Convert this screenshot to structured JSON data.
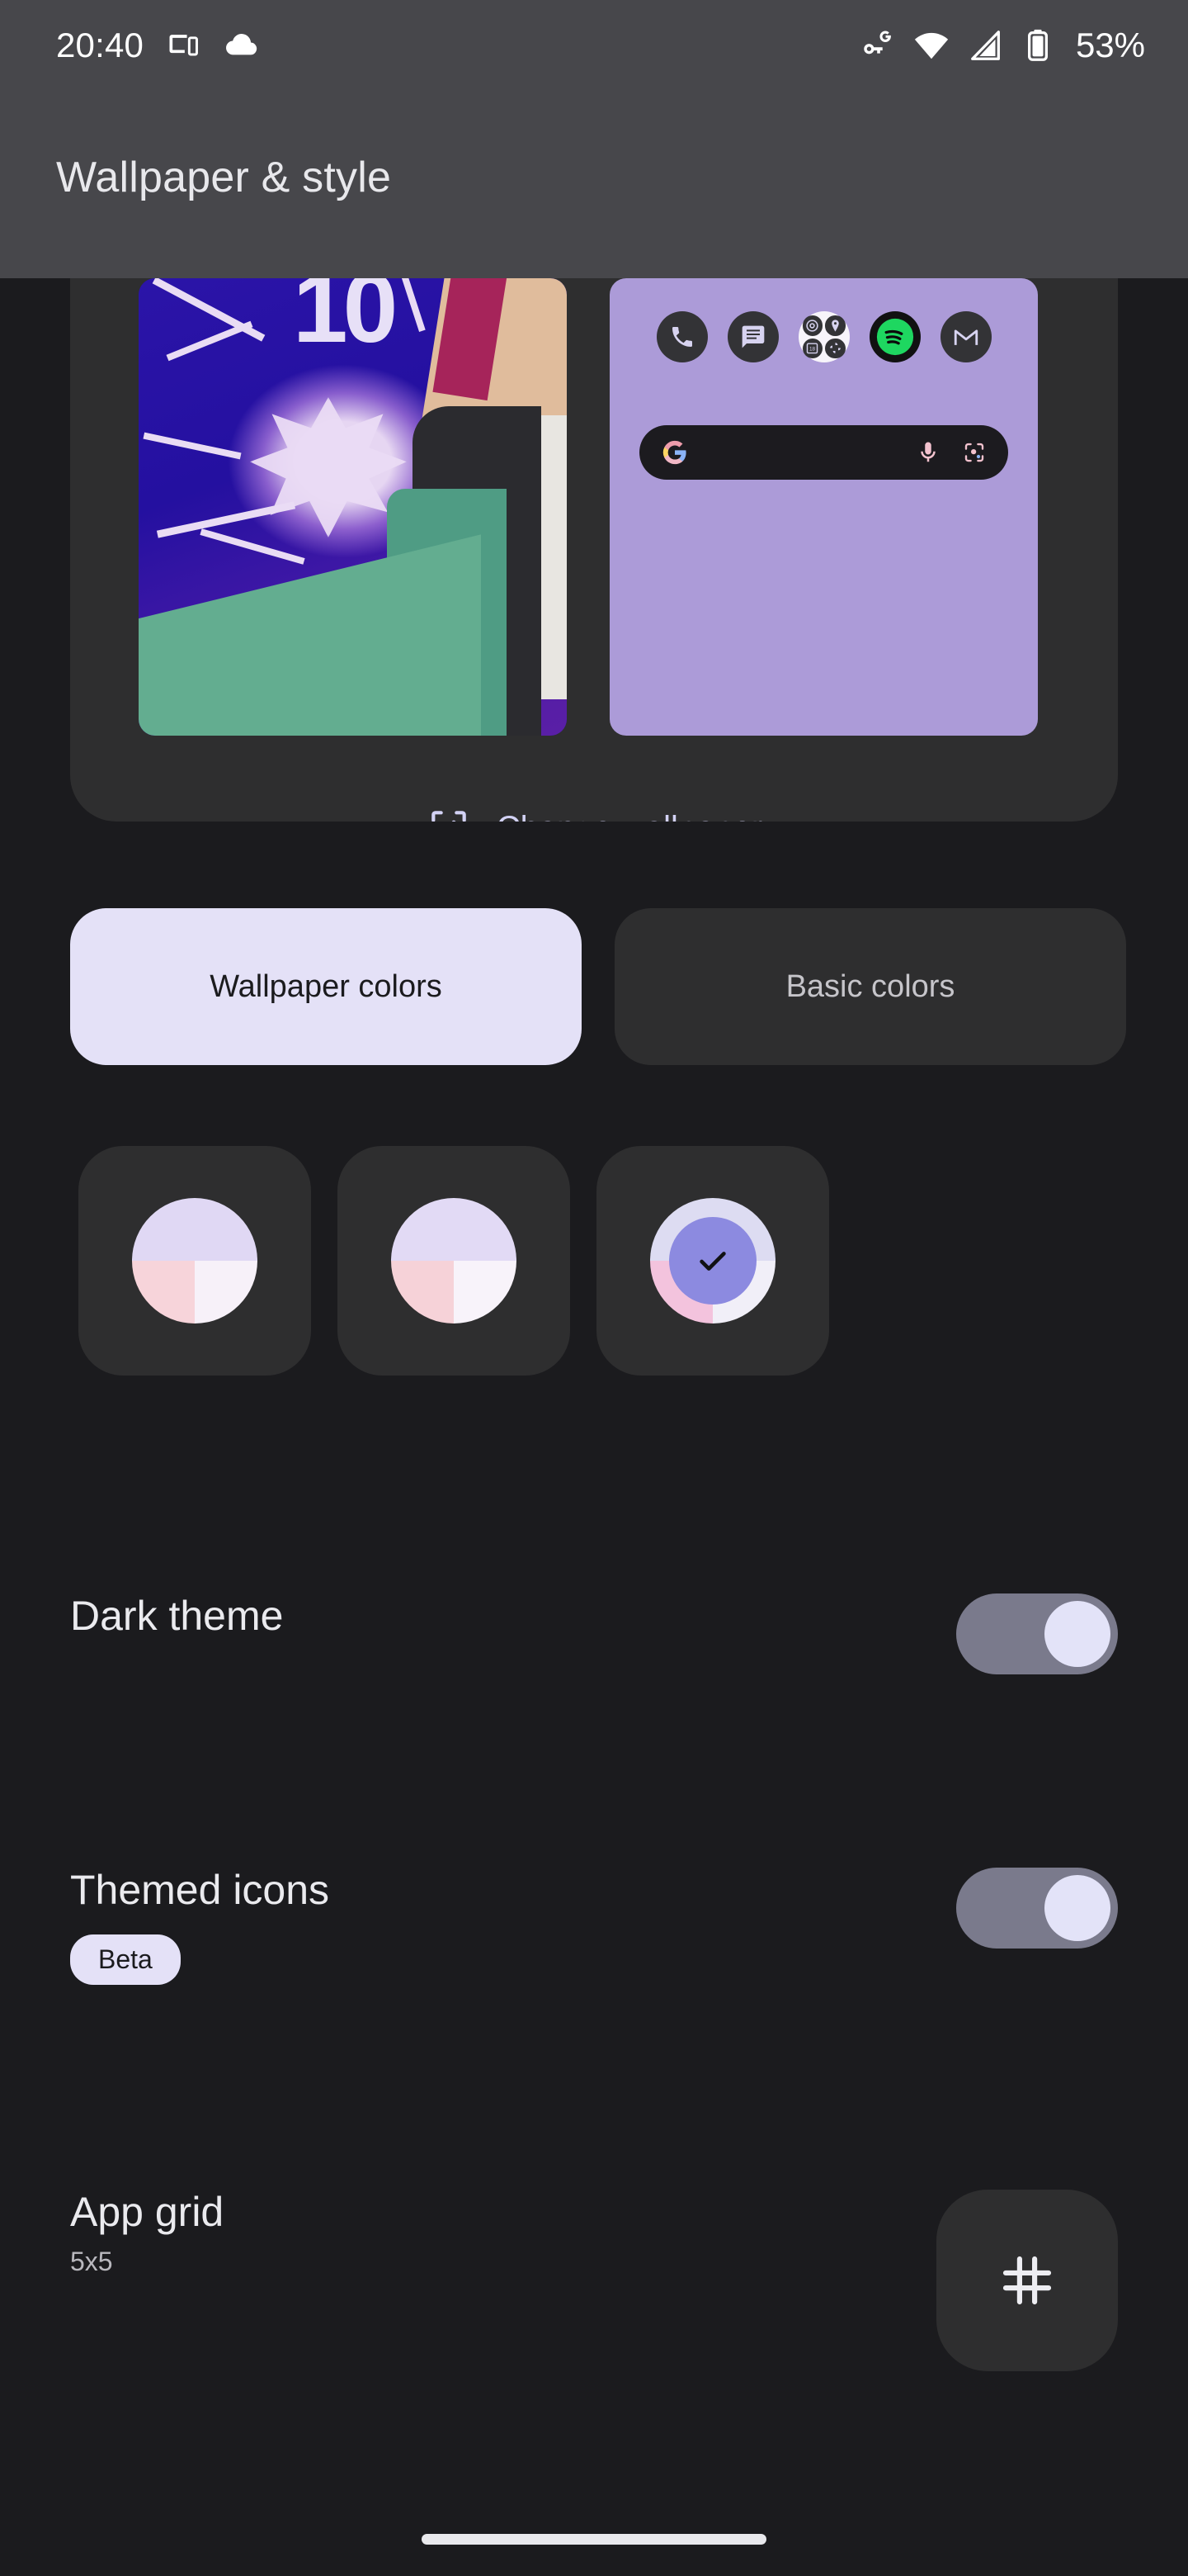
{
  "status_bar": {
    "time": "20:40",
    "battery_percent": "53%",
    "icons": [
      "cast-devices-icon",
      "cloud-icon",
      "vpn-key-g-icon",
      "wifi-icon",
      "mobile-signal-icon",
      "battery-icon"
    ]
  },
  "header": {
    "title": "Wallpaper & style"
  },
  "preview": {
    "lock_screen_label": "lock-screen-wallpaper-preview",
    "home_screen_label": "home-screen-preview",
    "home_apps": [
      "Phone",
      "Messages",
      "Google",
      "Spotify",
      "Gmail"
    ],
    "folder_apps": [
      "Chrome",
      "Maps",
      "Calendar",
      "Photos"
    ],
    "search_placeholder": "",
    "change_wallpaper_label": "Change wallpaper",
    "home_bg_color": "#AC9BD8",
    "search_bar_color": "#1C1B1F"
  },
  "color_tabs": [
    {
      "label": "Wallpaper colors",
      "selected": true
    },
    {
      "label": "Basic colors",
      "selected": false
    }
  ],
  "color_swatches": [
    {
      "name": "swatch-1",
      "selected": false,
      "top": "#E0D8F4",
      "bottom_left": "#F7D4DA",
      "bottom_right": "#F7F1F9"
    },
    {
      "name": "swatch-2",
      "selected": false,
      "top": "#E2DAF5",
      "bottom_left": "#F6D2D8",
      "bottom_right": "#F8F3FA"
    },
    {
      "name": "swatch-3",
      "selected": true,
      "top": "#DDDCF2",
      "bottom_left": "#F3C3DD",
      "bottom_right": "#F1EFF8",
      "inner": "#8C8AE0",
      "check": "✓"
    }
  ],
  "settings": {
    "dark_theme": {
      "title": "Dark theme",
      "enabled": true
    },
    "themed_icons": {
      "title": "Themed icons",
      "badge": "Beta",
      "enabled": true
    },
    "app_grid": {
      "title": "App grid",
      "subtitle": "5x5",
      "icon": "grid-hash-icon"
    }
  },
  "colors": {
    "page_background": "#1B1B1E",
    "header_background": "#47474B",
    "card_background": "#2E2E2F",
    "accent_light": "#E4E1F7",
    "toggle_track": "#7A7A8C",
    "toggle_thumb": "#E3E3F8"
  },
  "nav_bar": {
    "gesture_pill": "home-gesture-pill"
  }
}
